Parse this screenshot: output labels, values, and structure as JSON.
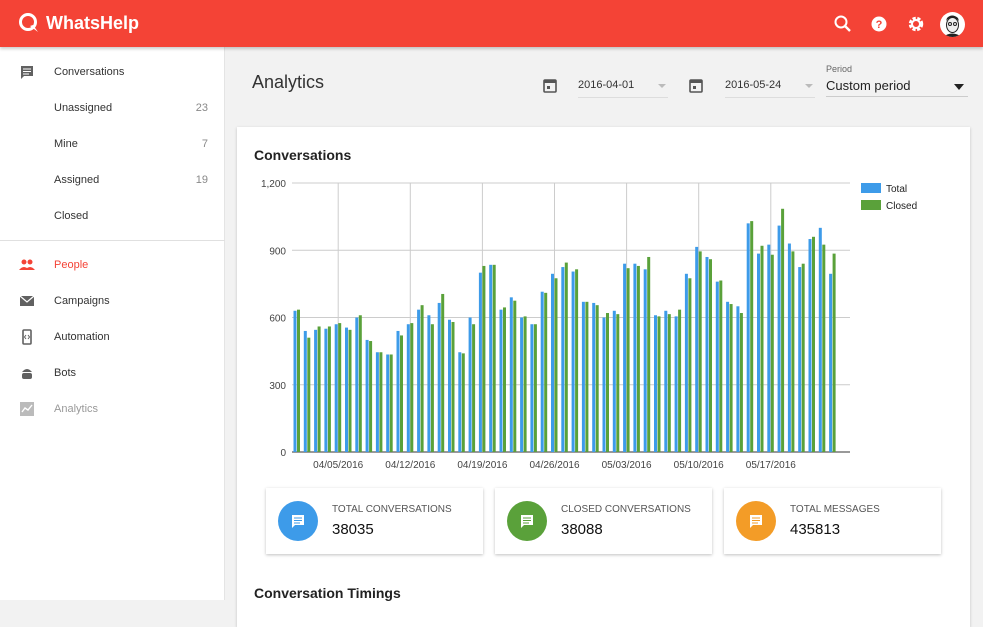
{
  "app": {
    "name": "WhatsHelp"
  },
  "header": {
    "icons": [
      "search-icon",
      "help-icon",
      "settings-icon",
      "avatar"
    ]
  },
  "sidebar": {
    "items": [
      {
        "label": "Conversations",
        "icon": "chat-icon"
      },
      {
        "label": "Unassigned",
        "count": "23"
      },
      {
        "label": "Mine",
        "count": "7"
      },
      {
        "label": "Assigned",
        "count": "19"
      },
      {
        "label": "Closed"
      },
      {
        "label": "People",
        "icon": "people-icon",
        "active": true
      },
      {
        "label": "Campaigns",
        "icon": "mail-icon"
      },
      {
        "label": "Automation",
        "icon": "automation-icon"
      },
      {
        "label": "Bots",
        "icon": "android-icon"
      },
      {
        "label": "Analytics",
        "icon": "analytics-icon"
      }
    ]
  },
  "page": {
    "title": "Analytics"
  },
  "filters": {
    "start_date": "2016-04-01",
    "end_date": "2016-05-24",
    "period_label": "Period",
    "period_value": "Custom period"
  },
  "colors": {
    "accent": "#f44336",
    "total": "#3d9be9",
    "closed": "#5aa13a",
    "messages": "#f39c27"
  },
  "card": {
    "title": "Conversations",
    "next_section": "Conversation Timings"
  },
  "stats": [
    {
      "label": "TOTAL CONVERSATIONS",
      "value": "38035",
      "color": "#3d9be9"
    },
    {
      "label": "CLOSED CONVERSATIONS",
      "value": "38088",
      "color": "#5aa13a"
    },
    {
      "label": "TOTAL MESSAGES",
      "value": "435813",
      "color": "#f39c27"
    }
  ],
  "chart_data": {
    "type": "bar",
    "title": "Conversations",
    "ylim": [
      0,
      1200
    ],
    "yticks": [
      "0",
      "300",
      "600",
      "900",
      "1,200"
    ],
    "ytick_values": [
      0,
      300,
      600,
      900,
      1200
    ],
    "xtick_labels": [
      "04/05/2016",
      "04/12/2016",
      "04/19/2016",
      "04/26/2016",
      "05/03/2016",
      "05/10/2016",
      "05/17/2016"
    ],
    "xtick_index": [
      4,
      11,
      18,
      25,
      32,
      39,
      46
    ],
    "legend": [
      "Total",
      "Closed"
    ],
    "legend_position": "right",
    "grid": true,
    "series": [
      {
        "name": "Total",
        "values": [
          630,
          540,
          545,
          550,
          570,
          555,
          600,
          500,
          445,
          435,
          540,
          570,
          635,
          610,
          665,
          590,
          445,
          600,
          800,
          835,
          635,
          690,
          600,
          570,
          715,
          795,
          825,
          805,
          670,
          665,
          600,
          630,
          840,
          840,
          815,
          610,
          630,
          605,
          795,
          915,
          870,
          760,
          670,
          650,
          1020,
          885,
          925,
          1010,
          930,
          825,
          950,
          1000,
          795
        ]
      },
      {
        "name": "Closed",
        "values": [
          635,
          510,
          560,
          560,
          575,
          545,
          610,
          495,
          445,
          435,
          520,
          575,
          655,
          570,
          705,
          580,
          440,
          570,
          830,
          835,
          645,
          675,
          605,
          570,
          710,
          775,
          845,
          815,
          670,
          655,
          620,
          615,
          820,
          830,
          870,
          605,
          615,
          635,
          775,
          895,
          860,
          765,
          660,
          620,
          1030,
          920,
          880,
          1085,
          895,
          840,
          960,
          925,
          885
        ]
      }
    ]
  }
}
